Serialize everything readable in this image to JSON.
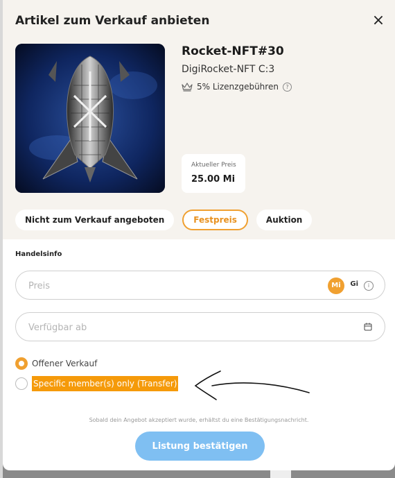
{
  "modal": {
    "title": "Artikel zum Verkauf anbieten",
    "close_symbol": "×"
  },
  "nft": {
    "name": "Rocket-NFT#30",
    "collection": "DigiRocket-NFT C:3",
    "royalty": "5% Lizenzgebühren",
    "price_label": "Aktueller Preis",
    "price_value": "25.00 Mi"
  },
  "tabs": [
    {
      "label": "Nicht zum Verkauf angeboten",
      "active": false
    },
    {
      "label": "Festpreis",
      "active": true
    },
    {
      "label": "Auktion",
      "active": false
    }
  ],
  "trade": {
    "section_label": "Handelsinfo",
    "price_placeholder": "Preis",
    "currency_primary": "Mi",
    "currency_secondary": "Gi",
    "available_placeholder": "Verfügbar ab",
    "option_open": "Offener Verkauf",
    "option_specific": "Specific member(s) only (Transfer)",
    "confirmation_note": "Sobald dein Angebot akzeptiert wurde, erhältst du eine Bestätigungsnachricht.",
    "confirm_label": "Listung bestätigen"
  },
  "colors": {
    "accent": "#f0a030",
    "confirm": "#7fbff2",
    "highlight": "#f59a0a"
  },
  "icons": [
    "close-icon",
    "crown-icon",
    "help-icon",
    "info-icon",
    "calendar-icon",
    "arrow-annotation"
  ]
}
